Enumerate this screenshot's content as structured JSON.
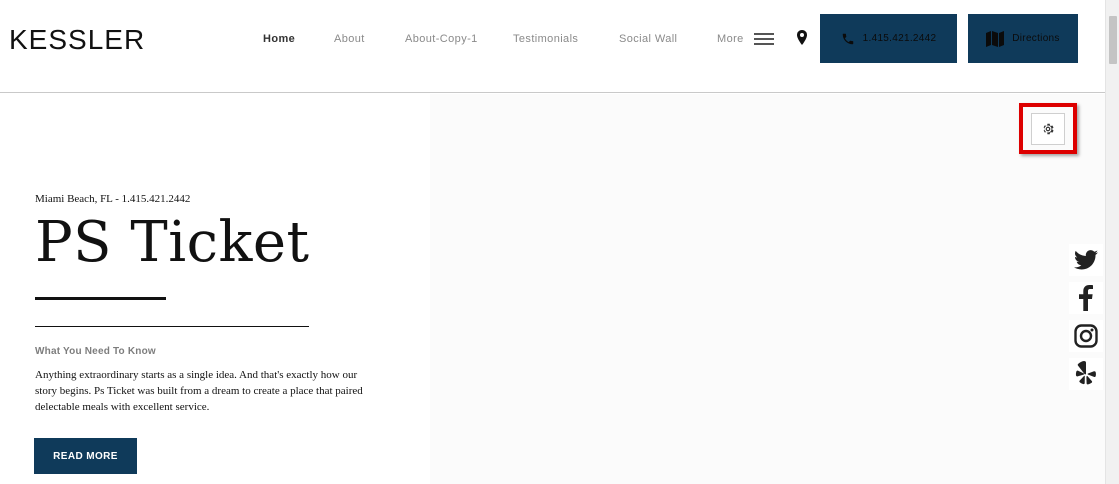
{
  "header": {
    "logo": "KESSLER",
    "nav": [
      "Home",
      "About",
      "About-Copy-1",
      "Testimonials",
      "Social Wall",
      "More"
    ],
    "phone_button": "1.415.421.2442",
    "directions_button": "Directions"
  },
  "hero": {
    "location": "Miami Beach, FL - 1.415.421.2442",
    "title": "PS Ticket",
    "subhead": "What You Need To Know",
    "paragraph": "Anything extraordinary starts as a single idea. And that's exactly how our story begins. Ps Ticket was built from a dream to create a place that paired delectable meals with excellent service.",
    "read_more": "READ MORE"
  },
  "icons": {
    "menu": "hamburger-icon",
    "location": "map-pin-icon",
    "phone": "phone-icon",
    "directions": "map-icon",
    "settings": "gear-icon",
    "social": [
      "twitter-icon",
      "facebook-icon",
      "instagram-icon",
      "yelp-icon"
    ]
  },
  "colors": {
    "accent": "#0f3a5a",
    "highlight": "#dd0000",
    "panel": "#fbfbfb"
  }
}
